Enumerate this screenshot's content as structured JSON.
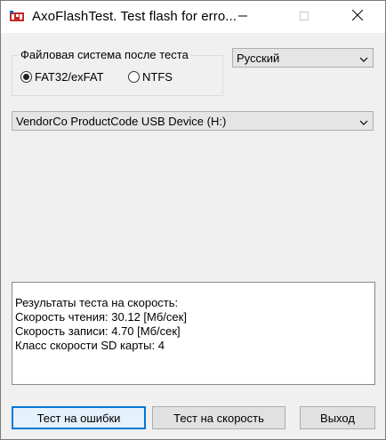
{
  "window": {
    "title": "AxoFlashTest. Test flash for erro...",
    "icon": "app-flash-icon",
    "controls": [
      "minimize-icon",
      "maximize-icon",
      "close-icon"
    ]
  },
  "filesystem": {
    "group_label": "Файловая система после теста",
    "options": [
      {
        "label": "FAT32/exFAT",
        "checked": true
      },
      {
        "label": "NTFS",
        "checked": false
      }
    ]
  },
  "language": {
    "selected": "Русский"
  },
  "device": {
    "selected": "VendorCo ProductCode USB Device (H:)"
  },
  "results": {
    "lines": [
      "Результаты теста на скорость:",
      "Скорость чтения: 30.12 [Мб/сек]",
      "Скорость записи: 4.70 [Мб/сек]",
      "Класс скорости SD карты: 4"
    ]
  },
  "buttons": {
    "test_errors": "Тест на ошибки",
    "test_speed": "Тест на скорость",
    "exit": "Выход"
  },
  "colors": {
    "accent": "#0078d7",
    "window_bg": "#f0f0f0",
    "button_bg": "#e1e1e1"
  }
}
